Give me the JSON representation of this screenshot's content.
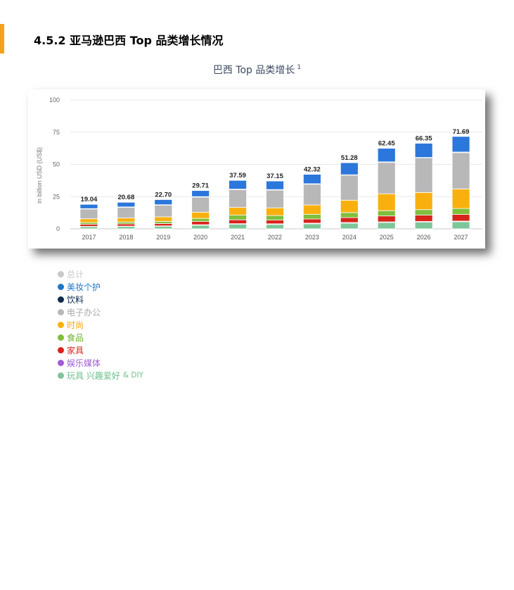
{
  "page": {
    "accent_color": "#f5a21b",
    "heading": "4.5.2 亚马逊巴西 Top 品类增长情况",
    "chart_title": "巴西 Top 品类增长",
    "chart_title_footnote": "1"
  },
  "chart_data": {
    "type": "bar",
    "stacked": true,
    "title": "巴西 Top 品类增长",
    "ylabel": "in billion USD (US$)",
    "xlabel": "",
    "ylim": [
      0,
      100
    ],
    "yticks": [
      0,
      25,
      50,
      75,
      100
    ],
    "grid": true,
    "legend_position": "bottom-left",
    "categories": [
      "2017",
      "2018",
      "2019",
      "2020",
      "2021",
      "2022",
      "2023",
      "2024",
      "2025",
      "2026",
      "2027"
    ],
    "totals": [
      19.04,
      20.68,
      22.7,
      29.71,
      37.59,
      37.15,
      42.32,
      51.28,
      62.45,
      66.35,
      71.69
    ],
    "total_labels": [
      "19.04",
      "20.68",
      "22.70",
      "29.71",
      "37.59",
      "37.15",
      "42.32",
      "51.28",
      "62.45",
      "66.35",
      "71.69"
    ],
    "series": [
      {
        "name": "玩具 兴趣爱好 & DIY",
        "color": "#7ec699",
        "values": [
          1.6,
          1.8,
          2.0,
          2.8,
          3.5,
          3.4,
          3.9,
          4.4,
          4.9,
          5.2,
          5.5
        ]
      },
      {
        "name": "娱乐媒体",
        "color": "#a05bd5",
        "values": [
          0.3,
          0.3,
          0.3,
          0.4,
          0.5,
          0.5,
          0.5,
          0.5,
          0.5,
          0.5,
          0.5
        ]
      },
      {
        "name": "家具",
        "color": "#d7231a",
        "values": [
          1.6,
          1.7,
          1.8,
          2.5,
          3.0,
          2.9,
          3.2,
          3.8,
          4.6,
          4.9,
          5.2
        ]
      },
      {
        "name": "食品",
        "color": "#7fbf3c",
        "values": [
          1.4,
          1.5,
          1.7,
          2.4,
          3.6,
          3.5,
          3.7,
          3.9,
          4.1,
          4.3,
          4.6
        ]
      },
      {
        "name": "时尚",
        "color": "#f9b00f",
        "values": [
          2.9,
          3.1,
          3.5,
          4.8,
          6.0,
          6.0,
          7.2,
          9.6,
          13.1,
          13.3,
          15.2
        ]
      },
      {
        "name": "电子办公",
        "color": "#b8b8b8",
        "values": [
          7.6,
          8.3,
          9.1,
          11.7,
          13.8,
          13.8,
          16.1,
          19.3,
          24.3,
          26.7,
          28.1
        ]
      },
      {
        "name": "饮料",
        "color": "#0d2c4e",
        "values": [
          0.3,
          0.3,
          0.3,
          0.4,
          0.4,
          0.4,
          0.4,
          0.5,
          0.5,
          0.5,
          0.5
        ]
      },
      {
        "name": "美妆个护",
        "color": "#2b77db",
        "values": [
          3.3,
          3.6,
          4.0,
          4.7,
          6.8,
          6.6,
          7.3,
          9.3,
          10.5,
          11.0,
          12.1
        ]
      }
    ]
  },
  "legend": [
    {
      "label": "总计",
      "color": "#c8c8c8",
      "text_color": "#c8c8c8"
    },
    {
      "label": "美妆个护",
      "color": "#1f77c8",
      "text_color": "#1f77c8"
    },
    {
      "label": "饮料",
      "color": "#0d2c4e",
      "text_color": "#0d2c4e"
    },
    {
      "label": "电子办公",
      "color": "#b8b8b8",
      "text_color": "#a8a8a8"
    },
    {
      "label": "时尚",
      "color": "#f9b00f",
      "text_color": "#f9a800"
    },
    {
      "label": "食品",
      "color": "#7fbf3c",
      "text_color": "#6bb02a"
    },
    {
      "label": "家具",
      "color": "#d7231a",
      "text_color": "#d7231a"
    },
    {
      "label": "娱乐媒体",
      "color": "#a05bd5",
      "text_color": "#a05bd5"
    },
    {
      "label": "玩具 兴趣爱好",
      "label_suffix": "& DIY",
      "color": "#7ec699",
      "text_color": "#6cbf8a"
    }
  ]
}
